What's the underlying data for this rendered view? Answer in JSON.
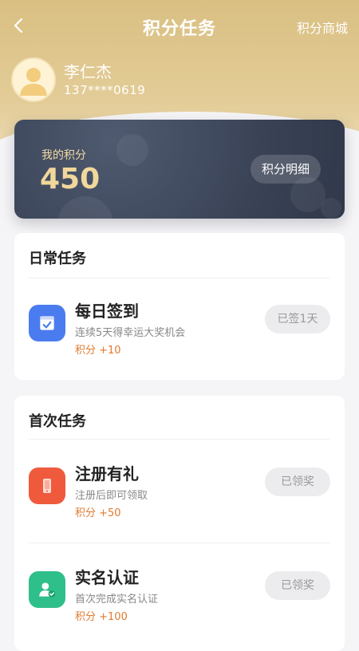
{
  "header": {
    "title": "积分任务",
    "mall_link": "积分商城"
  },
  "user": {
    "name": "李仁杰",
    "phone": "137****0619"
  },
  "points_card": {
    "label": "我的积分",
    "value": "450",
    "detail_button": "积分明细"
  },
  "sections": [
    {
      "title": "日常任务",
      "tasks": [
        {
          "name": "每日签到",
          "description": "连续5天得幸运大奖机会",
          "points": "积分 +10",
          "button": "已签1天",
          "icon": "checkin-calendar-icon",
          "icon_color": "#4a7cf0"
        }
      ]
    },
    {
      "title": "首次任务",
      "tasks": [
        {
          "name": "注册有礼",
          "description": "注册后即可领取",
          "points": "积分 +50",
          "button": "已领奖",
          "icon": "phone-icon",
          "icon_color": "#ef5a3d"
        },
        {
          "name": "实名认证",
          "description": "首次完成实名认证",
          "points": "积分 +100",
          "button": "已领奖",
          "icon": "user-verified-icon",
          "icon_color": "#2fbf8a"
        }
      ]
    }
  ],
  "colors": {
    "accent_gold": "#d9bf82",
    "points_orange": "#e07a2e",
    "card_dark": "#3a4356"
  }
}
